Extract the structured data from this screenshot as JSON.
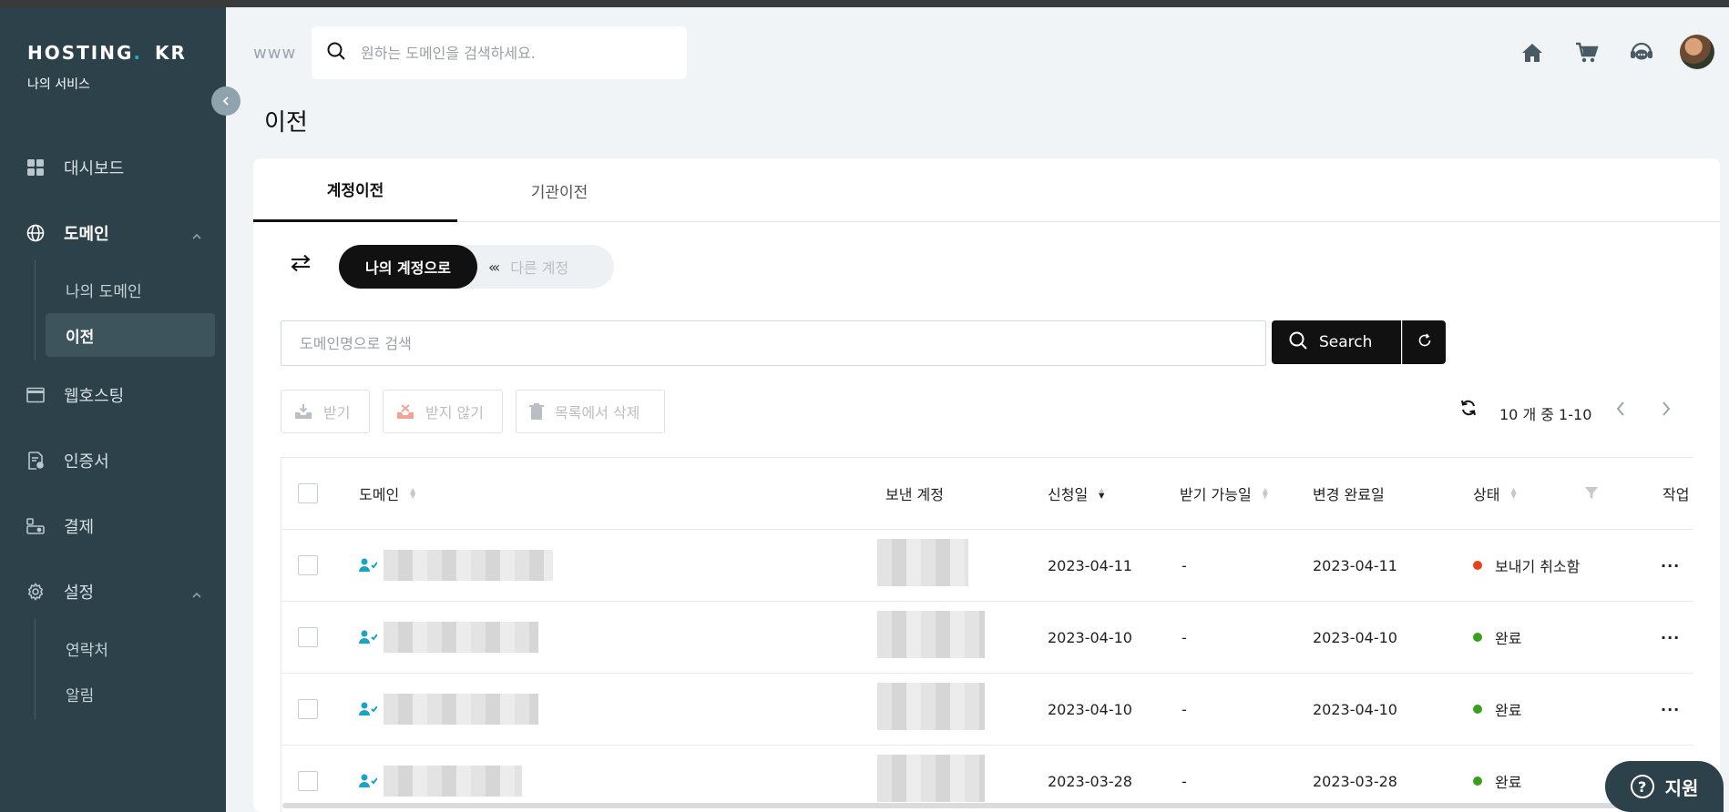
{
  "brand": {
    "logo_main": "HOSTING",
    "logo_dot": ".",
    "logo_tld": "KR",
    "subtitle": "나의 서비스"
  },
  "sidebar": {
    "items": [
      {
        "label": "대시보드",
        "icon": "grid-icon"
      },
      {
        "label": "도메인",
        "icon": "globe-icon",
        "expanded": true
      },
      {
        "label": "웹호스팅",
        "icon": "window-icon"
      },
      {
        "label": "인증서",
        "icon": "certificate-icon"
      },
      {
        "label": "결제",
        "icon": "payment-icon"
      },
      {
        "label": "설정",
        "icon": "gear-icon",
        "expanded": true
      }
    ],
    "domain_sub": [
      "나의 도메인",
      "이전"
    ],
    "settings_sub": [
      "연락처",
      "알림"
    ]
  },
  "header": {
    "www_label": "www",
    "search_placeholder": "원하는 도메인을 검색하세요."
  },
  "page": {
    "title": "이전"
  },
  "tabs": [
    "계정이전",
    "기관이전"
  ],
  "toggle": {
    "active": "나의 계정으로",
    "inactive": "다른 계정",
    "inactive_prefix": "‹‹‹"
  },
  "domain_search": {
    "placeholder": "도메인명으로 검색",
    "button": "Search"
  },
  "actions": [
    "받기",
    "받지 않기",
    "목록에서 삭제"
  ],
  "pager": {
    "info": "10 개 중 1-10"
  },
  "table": {
    "headers": {
      "domain": "도메인",
      "sender": "보낸 계정",
      "requested": "신청일",
      "receivable": "받기 가능일",
      "completed": "변경 완료일",
      "status": "상태",
      "action": "작업"
    },
    "rows": [
      {
        "requested": "2023-04-11",
        "receivable": "-",
        "completed": "2023-04-11",
        "status": "보내기 취소함",
        "status_color": "#e8421c",
        "more": "···"
      },
      {
        "requested": "2023-04-10",
        "receivable": "-",
        "completed": "2023-04-10",
        "status": "완료",
        "status_color": "#3aa01c",
        "more": "···"
      },
      {
        "requested": "2023-04-10",
        "receivable": "-",
        "completed": "2023-04-10",
        "status": "완료",
        "status_color": "#3aa01c",
        "more": "···"
      },
      {
        "requested": "2023-03-28",
        "receivable": "-",
        "completed": "2023-03-28",
        "status": "완료",
        "status_color": "#3aa01c",
        "more": "···"
      }
    ]
  },
  "support": {
    "label": "지원"
  }
}
